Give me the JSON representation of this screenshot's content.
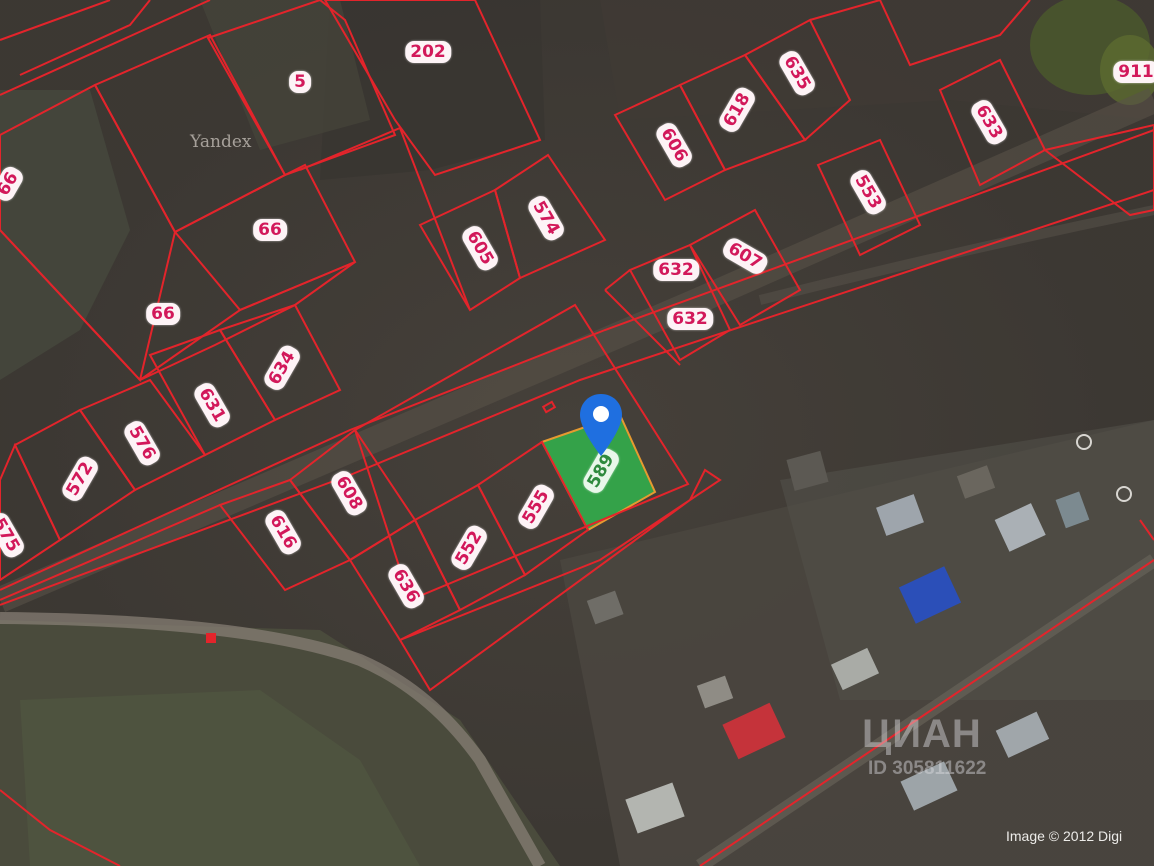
{
  "map": {
    "provider_watermark": "Yandex",
    "image_credit": "Image © 2012 Digi",
    "listing_watermark": {
      "brand": "ЦИАН",
      "id_text": "ID 305811622"
    },
    "selected_parcel": {
      "label": "589",
      "highlight_color": "#34a84a"
    },
    "parcel_line_color": "#e3242b",
    "parcel_labels": [
      "202",
      "5",
      "66",
      "66",
      "66",
      "605",
      "574",
      "606",
      "618",
      "635",
      "633",
      "553",
      "911",
      "632",
      "632",
      "607",
      "634",
      "631",
      "576",
      "572",
      "575",
      "608",
      "616",
      "636",
      "552",
      "555"
    ]
  }
}
